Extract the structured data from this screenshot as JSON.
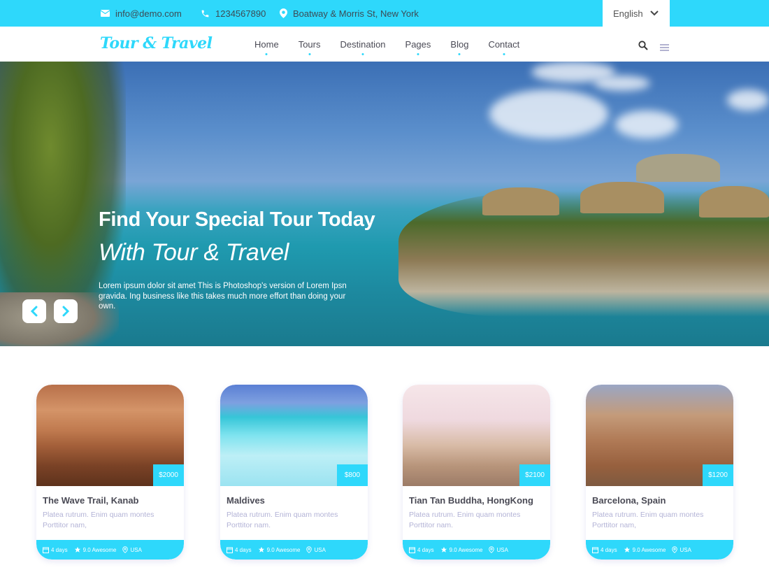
{
  "topbar": {
    "email": "info@demo.com",
    "phone": "1234567890",
    "address": "Boatway & Morris St, New York",
    "language": "English",
    "icons": {
      "email": "envelope-icon",
      "phone": "phone-icon",
      "address": "map-pin-icon",
      "language": "chevron-down-icon"
    }
  },
  "nav": {
    "logo": "Tour & Travel",
    "items": [
      {
        "label": "Home"
      },
      {
        "label": "Tours"
      },
      {
        "label": "Destination"
      },
      {
        "label": "Pages"
      },
      {
        "label": "Blog"
      },
      {
        "label": "Contact"
      }
    ],
    "icons": {
      "search": "search-icon",
      "menu": "hamburger-menu-icon"
    }
  },
  "hero": {
    "title": "Find Your Special Tour Today",
    "subtitle": "With Tour & Travel",
    "description": "Lorem ipsum dolor sit amet This is Photoshop's version of Lorem Ipsn gravida. Ing business like this takes much more effort than doing your own.",
    "prev_icon": "chevron-left-icon",
    "next_icon": "chevron-right-icon"
  },
  "tours": [
    {
      "title": "The Wave Trail, Kanab",
      "price": "$2000",
      "description": "Platea rutrum. Enim quam montes Porttitor nam,",
      "duration": "4 days",
      "rating": "9.0 Awesome",
      "location": "USA"
    },
    {
      "title": "Maldives",
      "price": "$800",
      "description": "Platea rutrum. Enim quam montes Porttitor nam.",
      "duration": "4 days",
      "rating": "9.0 Awesome",
      "location": "USA"
    },
    {
      "title": "Tian Tan Buddha, HongKong",
      "price": "$2100",
      "description": "Platea rutrum. Enim quam montes Porttitor nam.",
      "duration": "4 days",
      "rating": "9.0 Awesome",
      "location": "USA"
    },
    {
      "title": "Barcelona, Spain",
      "price": "$1200",
      "description": "Platea rutrum. Enim quam montes Porttitor nam,",
      "duration": "4 days",
      "rating": "9.0 Awesome",
      "location": "USA"
    }
  ],
  "colors": {
    "accent": "#2ed8fb",
    "text_dark": "#4a4a55",
    "text_muted": "#b3b3d6",
    "white": "#ffffff"
  }
}
